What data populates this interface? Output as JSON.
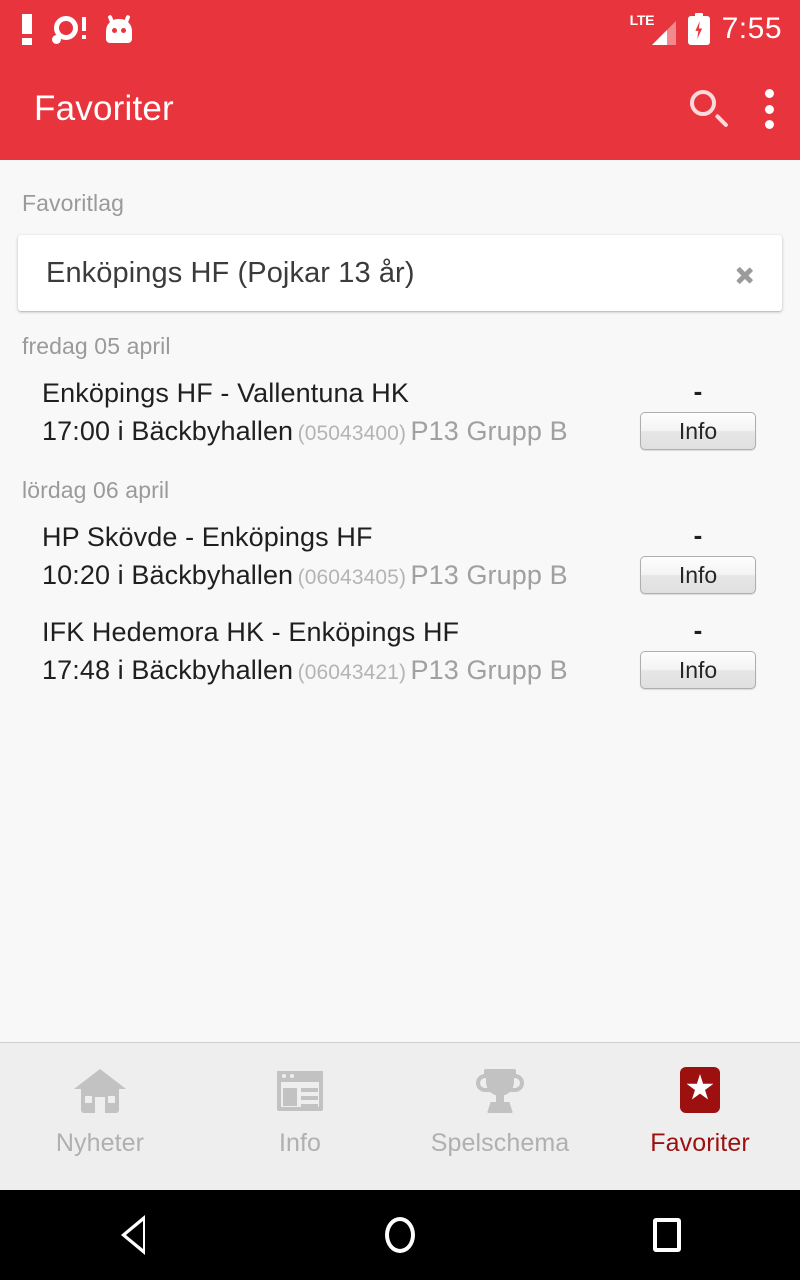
{
  "statusbar": {
    "time": "7:55",
    "icons_left": [
      "exclamation-icon",
      "disc-alert-icon",
      "android-head-icon"
    ],
    "network_label": "LTE",
    "icons_right": [
      "lte-signal-icon",
      "battery-charging-icon"
    ]
  },
  "appbar": {
    "title": "Favoriter",
    "search_icon": "search-icon",
    "overflow_icon": "overflow-menu-icon",
    "background_color": "#e8343c"
  },
  "content": {
    "favorite_section_label": "Favoritlag",
    "favorite_team": "Enköpings HF (Pojkar 13 år)",
    "favorite_chevron_icon": "chevron-right-icon",
    "info_button_label": "Info",
    "no_score_placeholder": "-",
    "groups": [
      {
        "date": "fredag 05 april",
        "matches": [
          {
            "teams": "Enköpings HF - Vallentuna HK",
            "time_venue": "17:00 i Bäckbyhallen",
            "match_id": "(05043400)",
            "group": "P13 Grupp B",
            "score": "-",
            "button": "Info"
          }
        ]
      },
      {
        "date": "lördag 06 april",
        "matches": [
          {
            "teams": "HP Skövde - Enköpings HF",
            "time_venue": "10:20 i Bäckbyhallen",
            "match_id": "(06043405)",
            "group": "P13 Grupp B",
            "score": "-",
            "button": "Info"
          },
          {
            "teams": "IFK Hedemora HK - Enköpings HF",
            "time_venue": "17:48 i Bäckbyhallen",
            "match_id": "(06043421)",
            "group": "P13 Grupp B",
            "score": "-",
            "button": "Info"
          }
        ]
      }
    ]
  },
  "tabbar": {
    "active_color": "#9c1010",
    "inactive_color": "#b0b0b0",
    "tabs": [
      {
        "label": "Nyheter",
        "icon": "house-icon",
        "active": false
      },
      {
        "label": "Info",
        "icon": "article-icon",
        "active": false
      },
      {
        "label": "Spelschema",
        "icon": "trophy-icon",
        "active": false
      },
      {
        "label": "Favoriter",
        "icon": "star-icon",
        "active": true
      }
    ]
  },
  "navbar": {
    "back_icon": "back-triangle-icon",
    "home_icon": "home-circle-icon",
    "recents_icon": "recents-square-icon"
  }
}
